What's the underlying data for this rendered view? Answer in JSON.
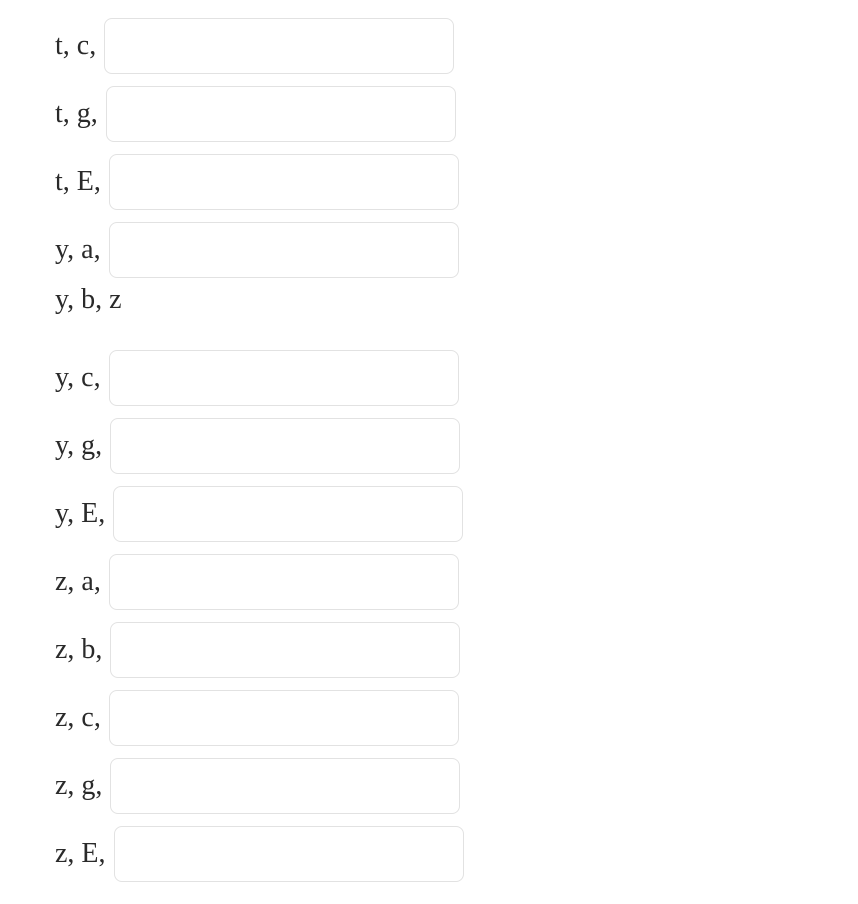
{
  "rows": [
    {
      "label": "t, c,",
      "has_input": true,
      "value": ""
    },
    {
      "label": "t, g,",
      "has_input": true,
      "value": ""
    },
    {
      "label": "t, E,",
      "has_input": true,
      "value": ""
    },
    {
      "label": "y, a,",
      "has_input": true,
      "value": ""
    },
    {
      "label": "y, b, z",
      "has_input": false,
      "value": ""
    },
    {
      "label": "y, c,",
      "has_input": true,
      "value": ""
    },
    {
      "label": "y, g,",
      "has_input": true,
      "value": ""
    },
    {
      "label": "y, E,",
      "has_input": true,
      "value": ""
    },
    {
      "label": "z, a,",
      "has_input": true,
      "value": ""
    },
    {
      "label": "z, b,",
      "has_input": true,
      "value": ""
    },
    {
      "label": "z, c,",
      "has_input": true,
      "value": ""
    },
    {
      "label": "z, g,",
      "has_input": true,
      "value": ""
    },
    {
      "label": "z, E,",
      "has_input": true,
      "value": ""
    }
  ]
}
